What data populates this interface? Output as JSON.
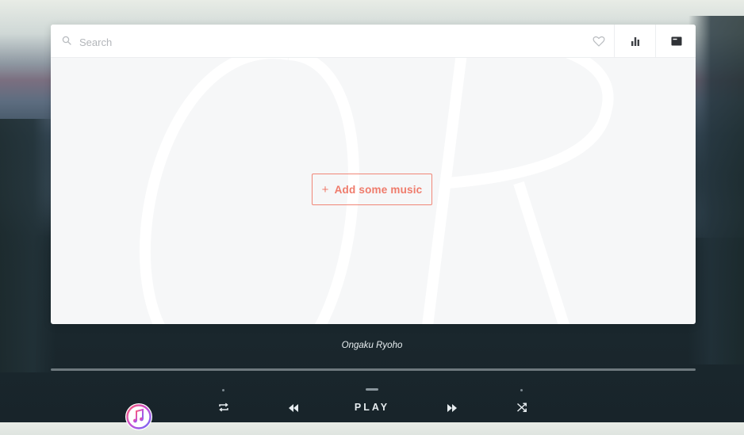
{
  "search": {
    "placeholder": "Search"
  },
  "toolbar": {
    "favorite_icon": "heart-icon",
    "equalizer_icon": "equalizer-icon",
    "playlist_icon": "playlist-icon"
  },
  "library": {
    "add_button_label": "Add some music",
    "add_button_icon": "+"
  },
  "player": {
    "track_title": "Ongaku Ryoho",
    "play_label": "PLAY",
    "progress": 0
  },
  "colors": {
    "accent": "#ef7b6b",
    "panel": "#f6f7f8"
  }
}
